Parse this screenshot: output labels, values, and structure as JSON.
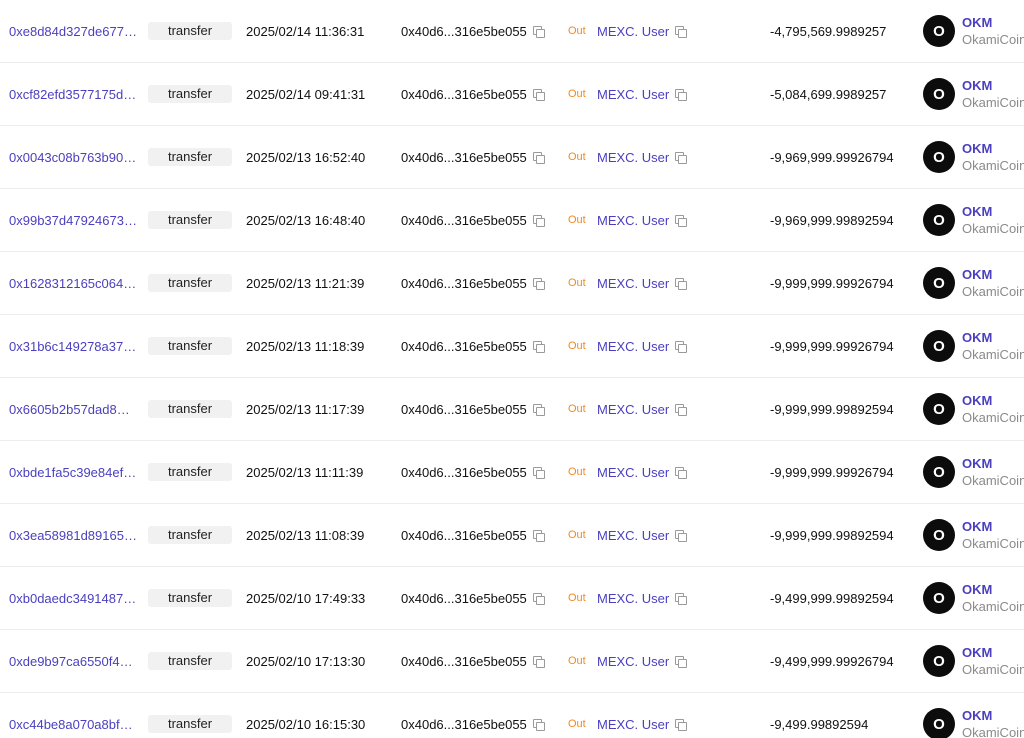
{
  "rows": [
    {
      "hash": "0xe8d84d327de677…",
      "method": "transfer",
      "time": "2025/02/14 11:36:31",
      "from": "0x40d6...316e5be055",
      "direction": "Out",
      "to": "MEXC. User",
      "amount": "-4,795,569.9989257",
      "token_symbol": "OKM",
      "token_name": "OkamiCoin",
      "token_logo": "O"
    },
    {
      "hash": "0xcf82efd3577175d…",
      "method": "transfer",
      "time": "2025/02/14 09:41:31",
      "from": "0x40d6...316e5be055",
      "direction": "Out",
      "to": "MEXC. User",
      "amount": "-5,084,699.9989257",
      "token_symbol": "OKM",
      "token_name": "OkamiCoin",
      "token_logo": "O"
    },
    {
      "hash": "0x0043c08b763b90…",
      "method": "transfer",
      "time": "2025/02/13 16:52:40",
      "from": "0x40d6...316e5be055",
      "direction": "Out",
      "to": "MEXC. User",
      "amount": "-9,969,999.99926794",
      "token_symbol": "OKM",
      "token_name": "OkamiCoin",
      "token_logo": "O"
    },
    {
      "hash": "0x99b37d47924673…",
      "method": "transfer",
      "time": "2025/02/13 16:48:40",
      "from": "0x40d6...316e5be055",
      "direction": "Out",
      "to": "MEXC. User",
      "amount": "-9,969,999.99892594",
      "token_symbol": "OKM",
      "token_name": "OkamiCoin",
      "token_logo": "O"
    },
    {
      "hash": "0x1628312165c064…",
      "method": "transfer",
      "time": "2025/02/13 11:21:39",
      "from": "0x40d6...316e5be055",
      "direction": "Out",
      "to": "MEXC. User",
      "amount": "-9,999,999.99926794",
      "token_symbol": "OKM",
      "token_name": "OkamiCoin",
      "token_logo": "O"
    },
    {
      "hash": "0x31b6c149278a37…",
      "method": "transfer",
      "time": "2025/02/13 11:18:39",
      "from": "0x40d6...316e5be055",
      "direction": "Out",
      "to": "MEXC. User",
      "amount": "-9,999,999.99926794",
      "token_symbol": "OKM",
      "token_name": "OkamiCoin",
      "token_logo": "O"
    },
    {
      "hash": "0x6605b2b57dad8…",
      "method": "transfer",
      "time": "2025/02/13 11:17:39",
      "from": "0x40d6...316e5be055",
      "direction": "Out",
      "to": "MEXC. User",
      "amount": "-9,999,999.99892594",
      "token_symbol": "OKM",
      "token_name": "OkamiCoin",
      "token_logo": "O"
    },
    {
      "hash": "0xbde1fa5c39e84ef…",
      "method": "transfer",
      "time": "2025/02/13 11:11:39",
      "from": "0x40d6...316e5be055",
      "direction": "Out",
      "to": "MEXC. User",
      "amount": "-9,999,999.99926794",
      "token_symbol": "OKM",
      "token_name": "OkamiCoin",
      "token_logo": "O"
    },
    {
      "hash": "0x3ea58981d89165…",
      "method": "transfer",
      "time": "2025/02/13 11:08:39",
      "from": "0x40d6...316e5be055",
      "direction": "Out",
      "to": "MEXC. User",
      "amount": "-9,999,999.99892594",
      "token_symbol": "OKM",
      "token_name": "OkamiCoin",
      "token_logo": "O"
    },
    {
      "hash": "0xb0daedc3491487…",
      "method": "transfer",
      "time": "2025/02/10 17:49:33",
      "from": "0x40d6...316e5be055",
      "direction": "Out",
      "to": "MEXC. User",
      "amount": "-9,499,999.99892594",
      "token_symbol": "OKM",
      "token_name": "OkamiCoin",
      "token_logo": "O"
    },
    {
      "hash": "0xde9b97ca6550f4…",
      "method": "transfer",
      "time": "2025/02/10 17:13:30",
      "from": "0x40d6...316e5be055",
      "direction": "Out",
      "to": "MEXC. User",
      "amount": "-9,499,999.99926794",
      "token_symbol": "OKM",
      "token_name": "OkamiCoin",
      "token_logo": "O"
    },
    {
      "hash": "0xc44be8a070a8bf…",
      "method": "transfer",
      "time": "2025/02/10 16:15:30",
      "from": "0x40d6...316e5be055",
      "direction": "Out",
      "to": "MEXC. User",
      "amount": "-9,499.99892594",
      "token_symbol": "OKM",
      "token_name": "OkamiCoin",
      "token_logo": "O"
    }
  ],
  "colors": {
    "link": "#4a3fbf",
    "out_badge": "#f08a1c",
    "token_logo_bg": "#0c0c0c",
    "muted": "#8a8a8a"
  },
  "icons": {
    "copy": "copy-icon"
  }
}
